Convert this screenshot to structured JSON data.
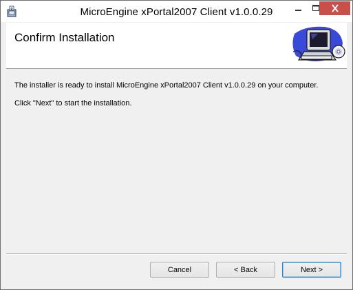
{
  "window": {
    "title": "MicroEngine xPortal2007 Client v1.0.0.29",
    "icons": {
      "app": "installer-icon",
      "minimize": "minimize-icon",
      "maximize": "maximize-icon",
      "close": "close-icon"
    },
    "close_color": "#c7504b"
  },
  "header": {
    "title": "Confirm Installation",
    "graphic": "computer-cd-icon"
  },
  "body": {
    "line1": "The installer is ready to install MicroEngine xPortal2007 Client v1.0.0.29 on your computer.",
    "line2": "Click \"Next\" to start the installation."
  },
  "buttons": {
    "cancel": "Cancel",
    "back": "< Back",
    "next": "Next >"
  }
}
